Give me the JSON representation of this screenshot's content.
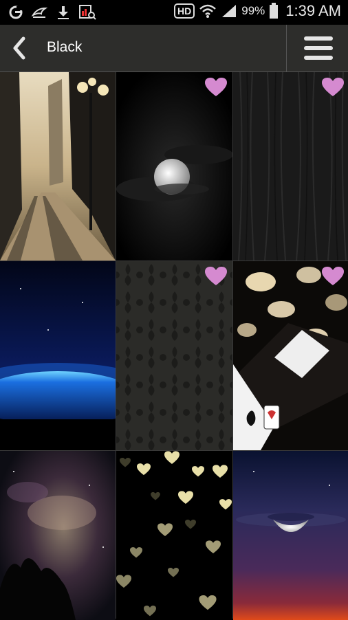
{
  "status_bar": {
    "battery_percent": "99%",
    "time": "1:39 AM",
    "hd_label": "HD",
    "left_icons": [
      "g-app-icon",
      "bird-app-icon",
      "download-icon",
      "image-search-icon"
    ]
  },
  "action_bar": {
    "title": "Black",
    "back_icon": "chevron-left-icon",
    "menu_icon": "hamburger-menu-icon"
  },
  "wallpapers": [
    {
      "subject": "city-street-sunset",
      "favorited": false
    },
    {
      "subject": "moon-night-clouds",
      "favorited": true
    },
    {
      "subject": "dark-wood-texture",
      "favorited": true
    },
    {
      "subject": "blue-planet-horizon",
      "favorited": false
    },
    {
      "subject": "damask-pattern",
      "favorited": true
    },
    {
      "subject": "playing-cards-bokeh",
      "favorited": true
    },
    {
      "subject": "nebula-space-trees",
      "favorited": false
    },
    {
      "subject": "golden-hearts-bokeh",
      "favorited": false
    },
    {
      "subject": "crescent-moon-purple-sky",
      "favorited": false
    }
  ],
  "colors": {
    "action_bar_bg": "#2d2d2b",
    "heart": "#d58ad0",
    "background": "#000000"
  }
}
